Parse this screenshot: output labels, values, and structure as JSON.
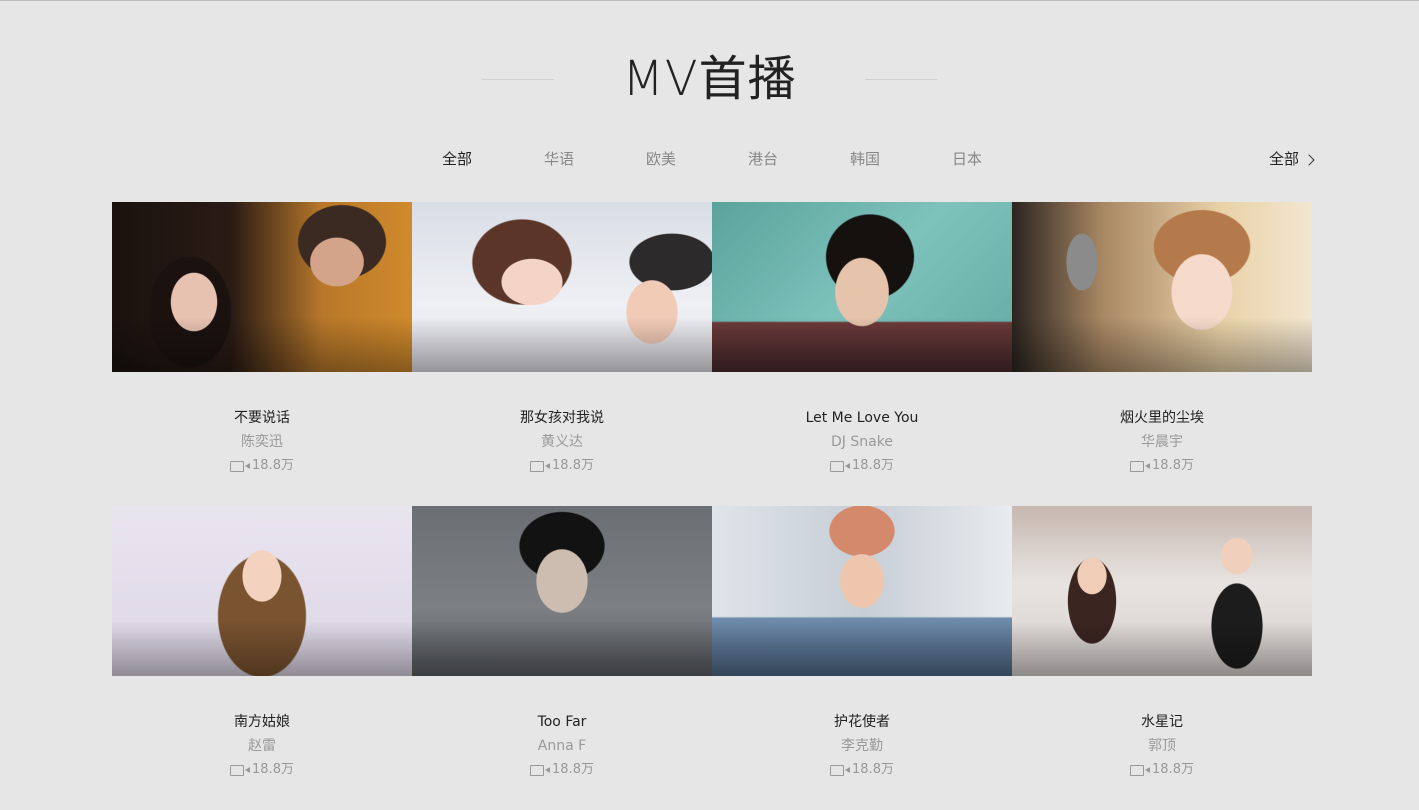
{
  "section": {
    "title": "MV首播"
  },
  "tabs": [
    {
      "label": "全部",
      "active": true
    },
    {
      "label": "华语",
      "active": false
    },
    {
      "label": "欧美",
      "active": false
    },
    {
      "label": "港台",
      "active": false
    },
    {
      "label": "韩国",
      "active": false
    },
    {
      "label": "日本",
      "active": false
    }
  ],
  "more": {
    "label": "全部",
    "icon": "chevron-right-icon"
  },
  "mvs": [
    {
      "title": "不要说话",
      "artist": "陈奕迅",
      "views": "18.8万",
      "icon": "video-icon"
    },
    {
      "title": "那女孩对我说",
      "artist": "黄义达",
      "views": "18.8万",
      "icon": "video-icon"
    },
    {
      "title": "Let Me Love You",
      "artist": "DJ Snake",
      "views": "18.8万",
      "icon": "video-icon"
    },
    {
      "title": "烟火里的尘埃",
      "artist": "华晨宇",
      "views": "18.8万",
      "icon": "video-icon"
    },
    {
      "title": "南方姑娘",
      "artist": "赵雷",
      "views": "18.8万",
      "icon": "video-icon"
    },
    {
      "title": "Too Far",
      "artist": "Anna F",
      "views": "18.8万",
      "icon": "video-icon"
    },
    {
      "title": "护花使者",
      "artist": "李克勤",
      "views": "18.8万",
      "icon": "video-icon"
    },
    {
      "title": "水星记",
      "artist": "郭顶",
      "views": "18.8万",
      "icon": "video-icon"
    }
  ],
  "colors": {
    "background": "#e6e6e6",
    "title_text": "#222222",
    "muted_text": "#999999"
  }
}
